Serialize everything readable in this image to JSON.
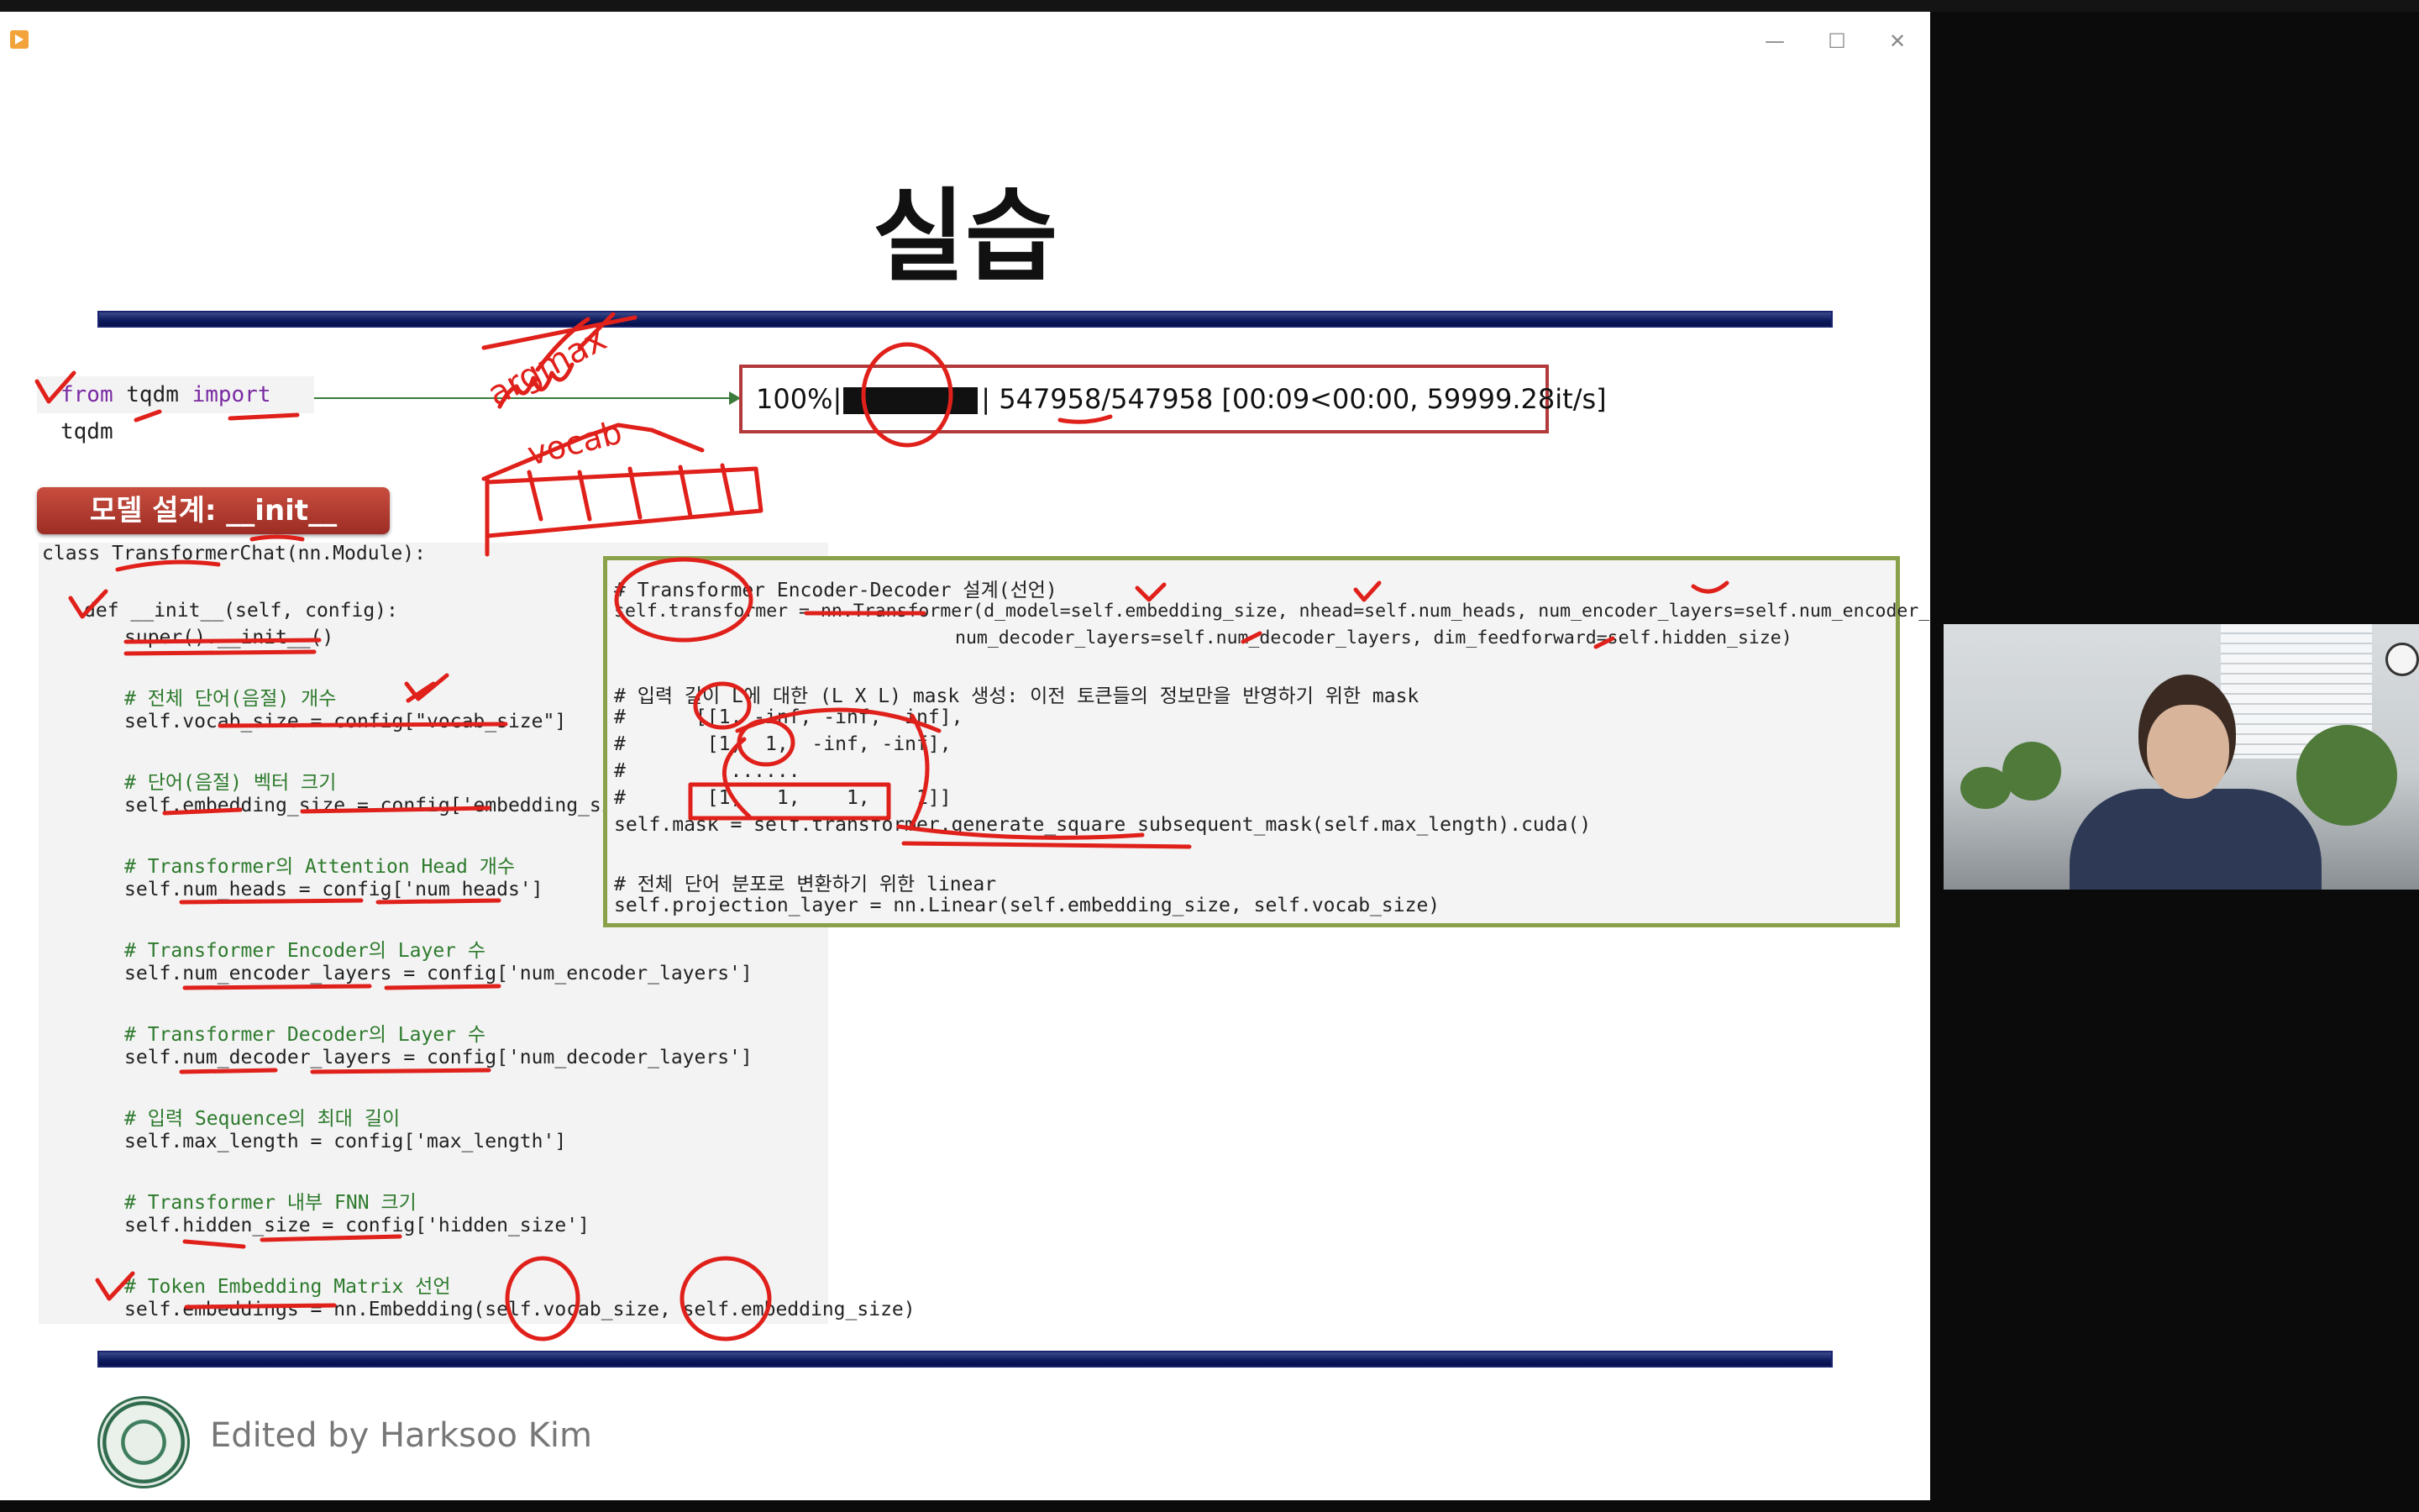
{
  "window": {
    "controls": [
      "—",
      "☐",
      "✕"
    ]
  },
  "slide": {
    "title": "실습",
    "import_line": {
      "kw_from": "from",
      "module": "tqdm",
      "kw_import": "import",
      "name": "tqdm"
    },
    "progress": {
      "percent": "100%|",
      "sep": "|",
      "count": "547958/547958",
      "timing": "[00:09<00:00, 59999.28it/s]"
    },
    "badge": "모델 설계: __init__",
    "code_left": [
      "class TransformerChat(nn.Module):",
      "def __init__(self, config):",
      "super().__init__()",
      "# 전체 단어(음절) 개수",
      "self.vocab_size = config[\"vocab_size\"]",
      "# 단어(음절) 벡터 크기",
      "self.embedding_size = config['embedding_size']",
      "# Transformer의 Attention Head 개수",
      "self.num_heads = config['num_heads']",
      "# Transformer Encoder의 Layer 수",
      "self.num_encoder_layers = config['num_encoder_layers']",
      "# Transformer Decoder의 Layer 수",
      "self.num_decoder_layers = config['num_decoder_layers']",
      "# 입력 Sequence의 최대 길이",
      "self.max_length = config['max_length']",
      "# Transformer 내부 FNN 크기",
      "self.hidden_size = config['hidden_size']",
      "# Token Embedding Matrix 선언",
      "self.embeddings = nn.Embedding(self.vocab_size, self.embedding_size)"
    ],
    "code_right": [
      "# Transformer Encoder-Decoder 설계(선언)",
      "self.transformer = nn.Transformer(d_model=self.embedding_size, nhead=self.num_heads, num_encoder_layers=self.num_encoder_layers,",
      "num_decoder_layers=self.num_decoder_layers, dim_feedforward=self.hidden_size)",
      "# 입력 길이 L에 대한 (L X L) mask 생성: 이전 토큰들의 정보만을 반영하기 위한 mask",
      "#      [[1, -inf, -inf, -inf],",
      "#       [1,  1,  -inf, -inf],",
      "#         ......",
      "#       [1,   1,    1,    1]]",
      "self.mask = self.transformer.generate_square_subsequent_mask(self.max_length).cuda()",
      "# 전체 단어 분포로 변환하기 위한 linear",
      "self.projection_layer = nn.Linear(self.embedding_size, self.vocab_size)"
    ],
    "footer": "Edited by Harksoo Kim"
  },
  "annotations": {
    "handwriting_1": "argmax",
    "handwriting_2": "vocab"
  },
  "colors": {
    "ink": "#e0201a",
    "title_bar": "#0c1a5c",
    "badge": "#b23a30",
    "code_frame": "#8aa04a"
  }
}
